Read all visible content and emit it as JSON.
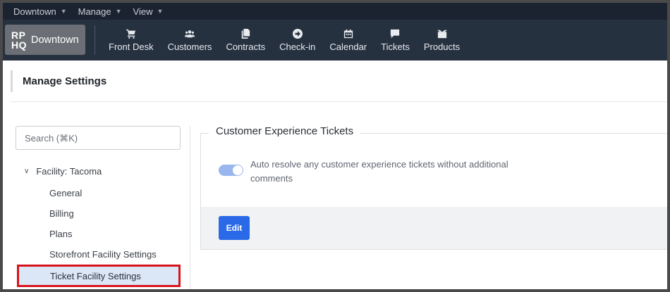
{
  "topbar": {
    "menus": [
      {
        "label": "Downtown"
      },
      {
        "label": "Manage"
      },
      {
        "label": "View"
      }
    ]
  },
  "brand": {
    "logo_line1": "RP",
    "logo_line2": "HQ",
    "name": "Downtown"
  },
  "nav": [
    {
      "label": "Front Desk",
      "icon": "cart-icon"
    },
    {
      "label": "Customers",
      "icon": "users-icon"
    },
    {
      "label": "Contracts",
      "icon": "documents-icon"
    },
    {
      "label": "Check-in",
      "icon": "arrow-circle-icon"
    },
    {
      "label": "Calendar",
      "icon": "calendar-icon"
    },
    {
      "label": "Tickets",
      "icon": "chat-icon"
    },
    {
      "label": "Products",
      "icon": "boxes-icon"
    }
  ],
  "page": {
    "title": "Manage Settings"
  },
  "sidebar": {
    "search_placeholder": "Search (⌘K)",
    "facility": "Facility: Tacoma",
    "items": [
      {
        "label": "General"
      },
      {
        "label": "Billing"
      },
      {
        "label": "Plans"
      },
      {
        "label": "Storefront Facility Settings"
      },
      {
        "label": "Ticket Facility Settings"
      }
    ]
  },
  "main": {
    "section_title": "Customer Experience Tickets",
    "toggle_label": "Auto resolve any customer experience tickets without additional comments",
    "edit_label": "Edit"
  },
  "colors": {
    "nav_bg": "#263140",
    "topbar_bg": "#1b2330",
    "accent": "#2a6ae8",
    "highlight_border": "#d8131c",
    "active_item_bg": "#dbe7f7"
  }
}
